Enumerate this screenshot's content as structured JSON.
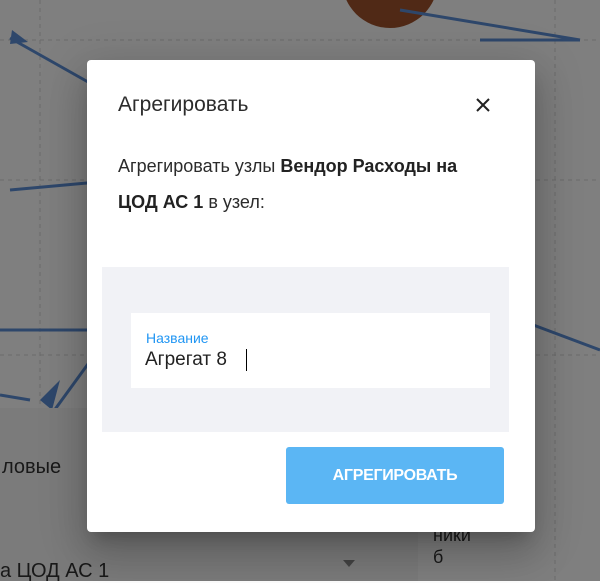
{
  "background": {
    "side_panel_label": "ловые",
    "select_value": "а ЦОД АС 1",
    "note_text": "ники\nб"
  },
  "dialog": {
    "title": "Агрегировать",
    "message_prefix": "Агрегировать узлы ",
    "message_nodes": "Вендор Расходы на ЦОД АС 1",
    "message_suffix": " в узел:",
    "name_field_label": "Название",
    "name_field_value": "Агрегат 8",
    "submit_label": "АГРЕГИРОВАТЬ"
  },
  "colors": {
    "accent": "#2196f3",
    "button": "#5bb6f4",
    "form_background": "#f1f2f6",
    "overlay": "rgba(0,0,0,0.5)",
    "node": "#a0522d",
    "edges": "#5c8fd6"
  },
  "icons": {
    "close": "close-icon",
    "dropdown": "chevron-down-icon"
  }
}
